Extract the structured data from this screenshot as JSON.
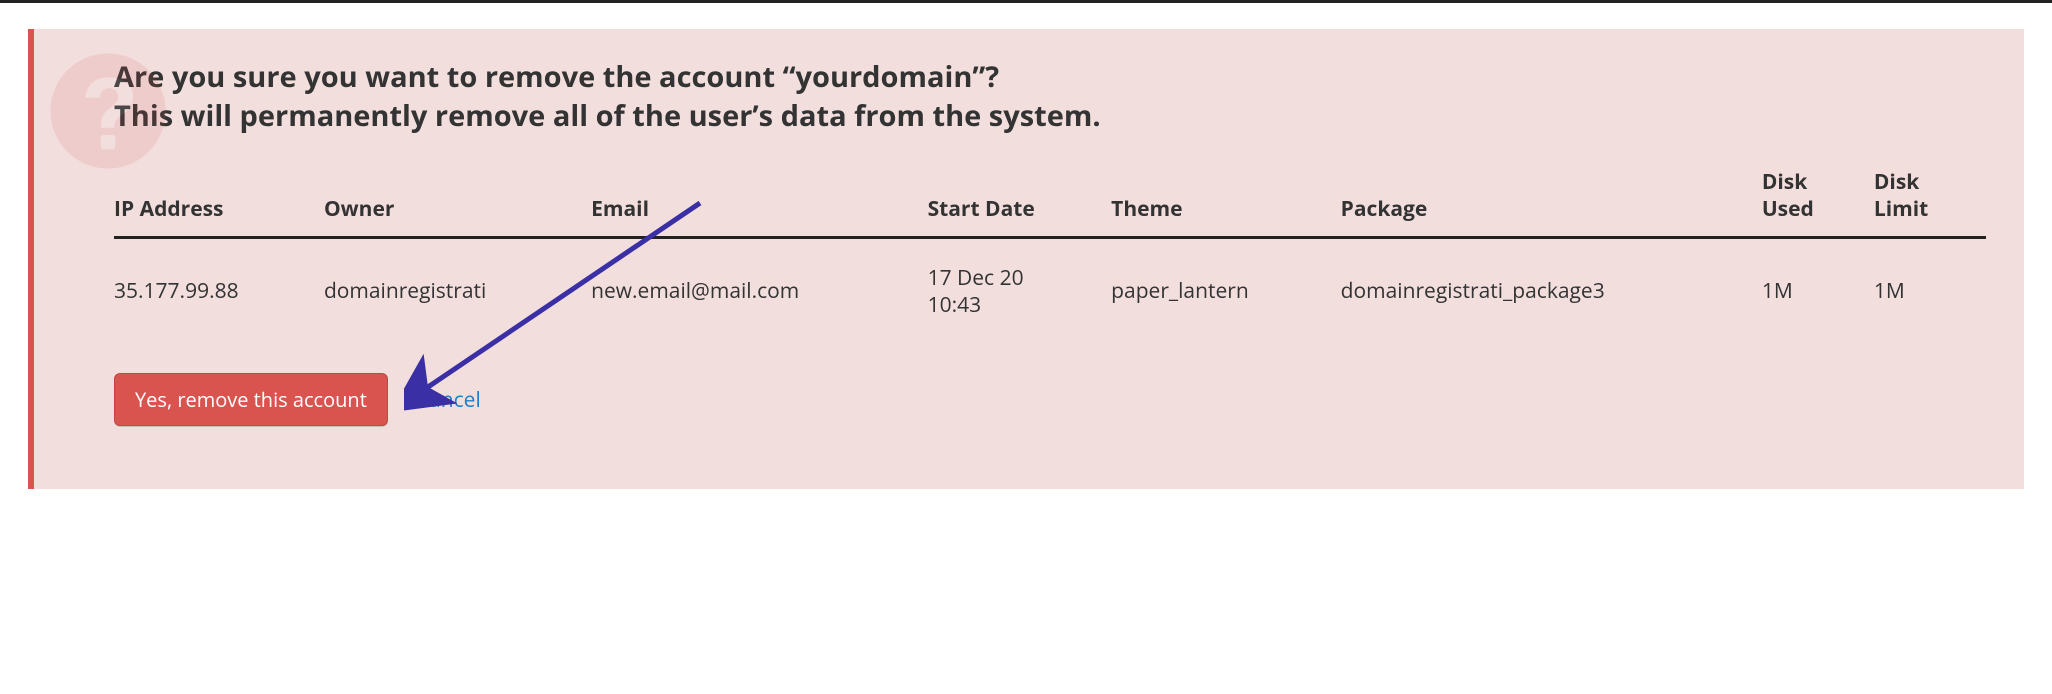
{
  "alert": {
    "heading_line1": "Are you sure you want to remove the account “yourdomain”?",
    "heading_line2": "This will permanently remove all of the user’s data from the system."
  },
  "table": {
    "headers": {
      "ip": "IP Address",
      "owner": "Owner",
      "email": "Email",
      "start_date": "Start Date",
      "theme": "Theme",
      "package": "Package",
      "disk_used": "Disk Used",
      "disk_limit": "Disk Limit"
    },
    "row": {
      "ip": "35.177.99.88",
      "owner": "domainregistrati",
      "email": "new.email@mail.com",
      "start_date_line1": "17 Dec 20",
      "start_date_line2": "10:43",
      "theme": "paper_lantern",
      "package": "domainregistrati_package3",
      "disk_used": "1M",
      "disk_limit": "1M"
    }
  },
  "actions": {
    "confirm_label": "Yes, remove this account",
    "cancel_label": "Cancel"
  },
  "colors": {
    "danger": "#d9534f",
    "alert_bg": "#f2dedd",
    "link": "#1e7fc7",
    "arrow": "#3b2fa6"
  }
}
